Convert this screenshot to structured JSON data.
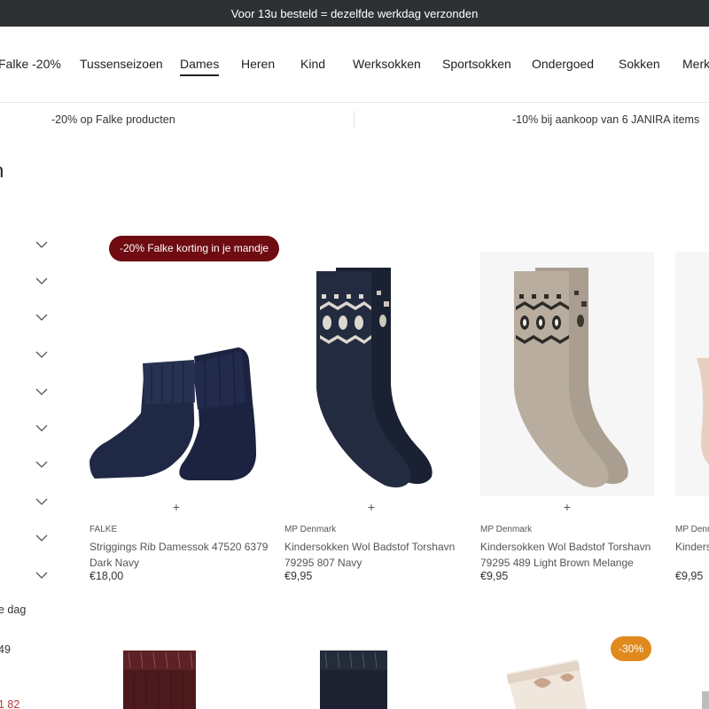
{
  "topbar": {
    "text": "Voor 13u besteld = dezelfde werkdag verzonden"
  },
  "nav": {
    "items": [
      {
        "label": "Falke -20%"
      },
      {
        "label": "Tussenseizoen"
      },
      {
        "label": "Dames"
      },
      {
        "label": "Heren"
      },
      {
        "label": "Kind"
      },
      {
        "label": "Werksokken"
      },
      {
        "label": "Sportsokken"
      },
      {
        "label": "Ondergoed"
      },
      {
        "label": "Sokken"
      },
      {
        "label": "Merk"
      }
    ]
  },
  "promos": [
    {
      "text": "-20% op Falke producten"
    },
    {
      "text": "-10% bij aankoop van 6 JANIRA items"
    }
  ],
  "page_title": "n",
  "sidebar": {
    "snippets": [
      {
        "text": "e dag"
      },
      {
        "text": "49"
      },
      {
        "text": "1 82"
      }
    ]
  },
  "products": [
    {
      "badge": "-20% Falke korting in je mandje",
      "brand": "FALKE",
      "name": "Striggings Rib Damessok 47520 6379 Dark Navy",
      "price": "€18,00",
      "add_label": "+"
    },
    {
      "brand": "MP Denmark",
      "name": "Kindersokken Wol Badstof Torshavn 79295 807 Navy",
      "price": "€9,95",
      "add_label": "+"
    },
    {
      "brand": "MP Denmark",
      "name": "Kindersokken Wol Badstof Torshavn 79295 489 Light Brown Melange",
      "price": "€9,95",
      "add_label": "+"
    },
    {
      "brand": "MP Denm",
      "name": "Kinders 79295 8",
      "price": "€9,95",
      "add_label": "+"
    }
  ],
  "second_row": {
    "badge": "-30%"
  },
  "colors": {
    "topbar_bg": "#2e3133",
    "badge_falke": "#6e0c12",
    "badge_discount": "#e08a1e",
    "navy_sock": "#1d2436",
    "beige_sock": "#b5aa9b",
    "burgundy_sock": "#5a1c1f"
  }
}
